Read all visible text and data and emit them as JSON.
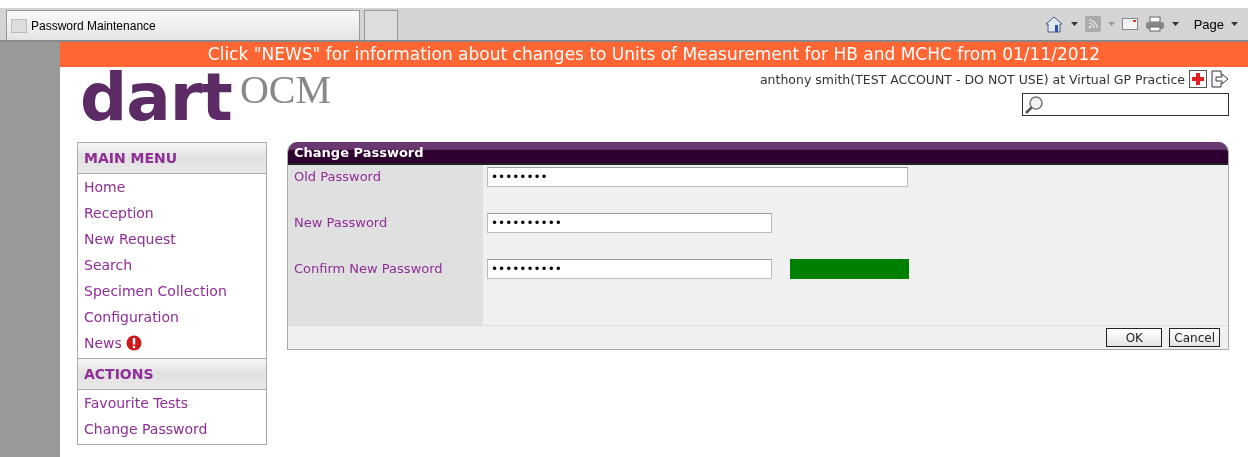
{
  "browser": {
    "tab_title": "Password Maintenance",
    "page_menu": "Page"
  },
  "banner": "Click \"NEWS\" for information about changes to Units of Measurement for HB and MCHC from 01/11/2012",
  "logo": {
    "brand": "dart",
    "product": "OCM"
  },
  "user_info": "anthony smith(TEST ACCOUNT - DO NOT USE) at Virtual GP Practice",
  "sidebar": [
    {
      "heading": "MAIN MENU",
      "items": [
        {
          "label": "Home",
          "alert": false
        },
        {
          "label": "Reception",
          "alert": false
        },
        {
          "label": "New Request",
          "alert": false
        },
        {
          "label": "Search",
          "alert": false
        },
        {
          "label": "Specimen Collection",
          "alert": false
        },
        {
          "label": "Configuration",
          "alert": false
        },
        {
          "label": "News",
          "alert": true
        }
      ]
    },
    {
      "heading": "ACTIONS",
      "items": [
        {
          "label": "Favourite Tests",
          "alert": false
        },
        {
          "label": "Change Password",
          "alert": false
        }
      ]
    }
  ],
  "form": {
    "title": "Change Password",
    "fields": [
      {
        "label": "Old Password",
        "value": "••••••••",
        "kind": "wide"
      },
      {
        "label": "New Password",
        "value": "••••••••••",
        "kind": "short"
      },
      {
        "label": "Confirm New Password",
        "value": "••••••••••",
        "kind": "strength"
      }
    ],
    "buttons": [
      "OK",
      "Cancel"
    ]
  }
}
